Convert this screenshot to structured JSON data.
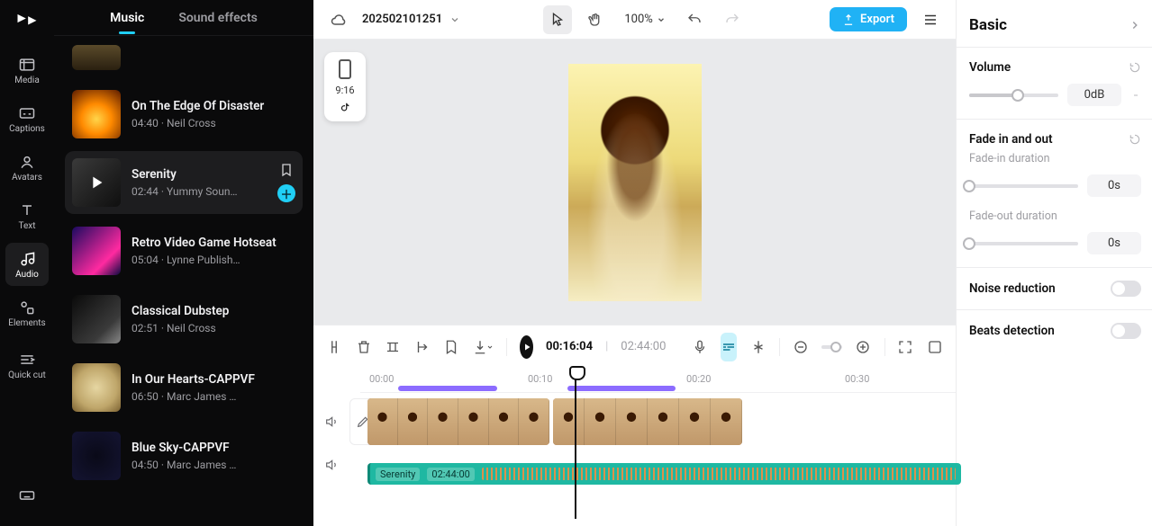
{
  "rail": {
    "items": [
      {
        "label": "Media"
      },
      {
        "label": "Captions"
      },
      {
        "label": "Avatars"
      },
      {
        "label": "Text"
      },
      {
        "label": "Audio"
      },
      {
        "label": "Elements"
      },
      {
        "label": "Quick cut"
      }
    ]
  },
  "music_panel": {
    "tabs": {
      "music": "Music",
      "sfx": "Sound effects"
    },
    "tracks": [
      {
        "title": "On The Edge Of Disaster",
        "sub": "04:40 · Neil Cross"
      },
      {
        "title": "Serenity",
        "sub": "02:44 · Yummy Soun…"
      },
      {
        "title": "Retro Video Game Hotseat",
        "sub": "05:04 · Lynne Publish…"
      },
      {
        "title": "Classical Dubstep",
        "sub": "02:51 · Neil Cross"
      },
      {
        "title": "In Our Hearts-CAPPVF",
        "sub": "06:50 · Marc James …"
      },
      {
        "title": "Blue Sky-CAPPVF",
        "sub": "04:50 · Marc James …"
      }
    ]
  },
  "topbar": {
    "project": "202502101251",
    "zoom": "100%",
    "export": "Export"
  },
  "preview": {
    "ratio": "9:16"
  },
  "timeline": {
    "toolbar": {
      "current": "00:16:04",
      "total": "02:44:00"
    },
    "ticks": [
      "00:00",
      "00:10",
      "00:20",
      "00:30"
    ],
    "audio_clip": {
      "name": "Serenity",
      "duration": "02:44:00"
    }
  },
  "props": {
    "title": "Basic",
    "volume": {
      "label": "Volume",
      "value": "0dB"
    },
    "fade": {
      "label": "Fade in and out",
      "in_label": "Fade-in duration",
      "in_value": "0s",
      "out_label": "Fade-out duration",
      "out_value": "0s"
    },
    "noise": {
      "label": "Noise reduction"
    },
    "beats": {
      "label": "Beats detection"
    }
  }
}
